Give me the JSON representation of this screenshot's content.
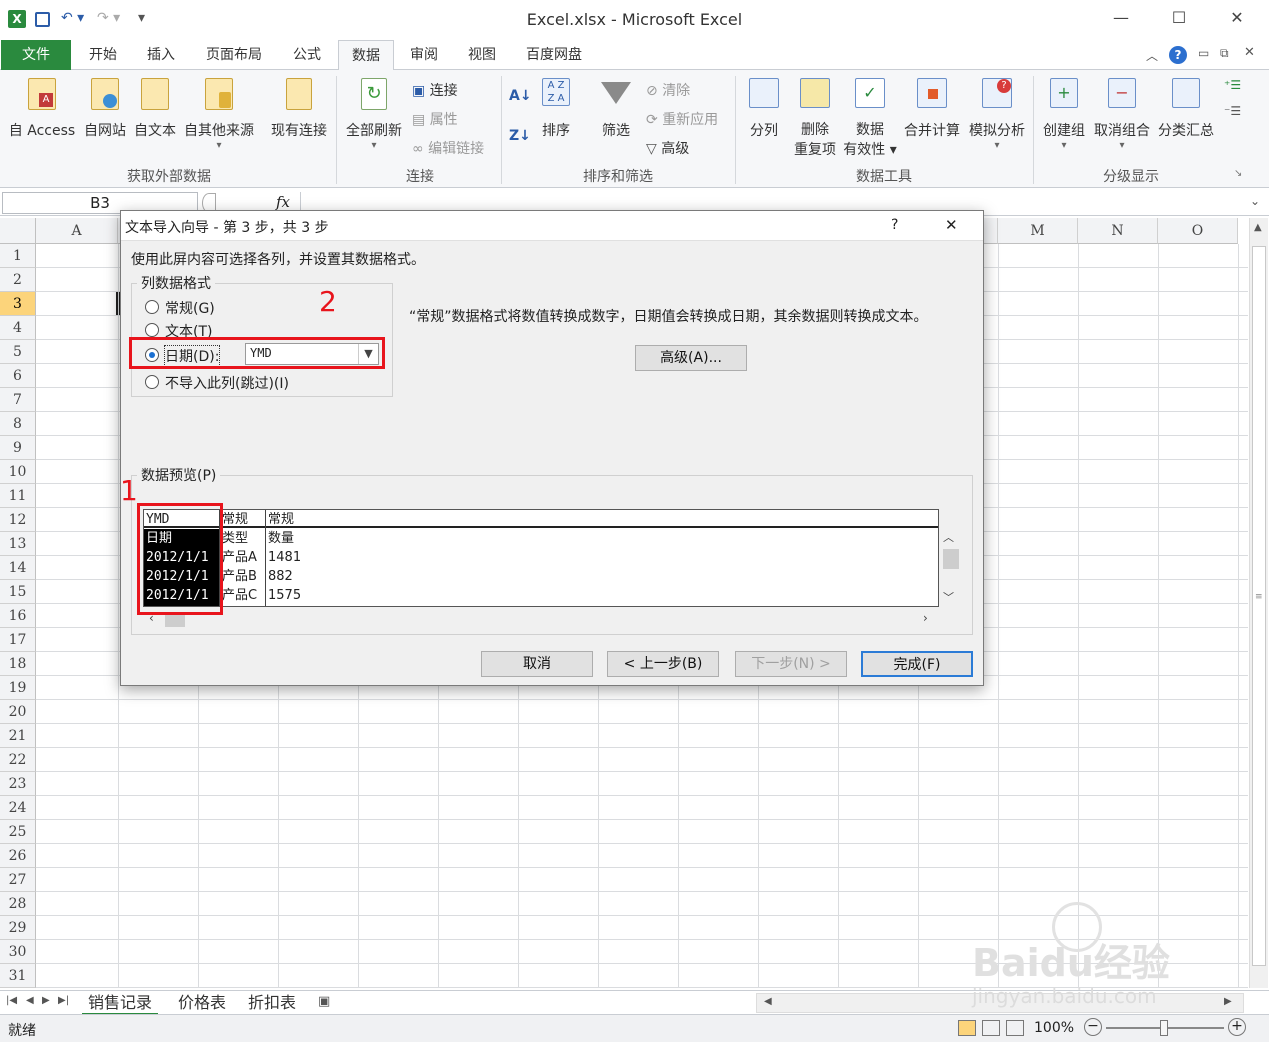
{
  "window": {
    "title": "Excel.xlsx - Microsoft Excel"
  },
  "quick_access": {
    "undo_label": "↶",
    "redo_label": "↷"
  },
  "window_controls": {
    "minimize": "—",
    "maximize": "☐",
    "close": "✕"
  },
  "tabs": [
    "文件",
    "开始",
    "插入",
    "页面布局",
    "公式",
    "数据",
    "审阅",
    "视图",
    "百度网盘"
  ],
  "active_tab": "数据",
  "ribbon": {
    "get_external": {
      "buttons": [
        "自 Access",
        "自网站",
        "自文本",
        "自其他来源",
        "现有连接"
      ],
      "group_label": "获取外部数据"
    },
    "connections": {
      "refresh_all": "全部刷新",
      "connections": "连接",
      "properties": "属性",
      "edit_links": "编辑链接",
      "group_label": "连接"
    },
    "sort_filter": {
      "sort": "排序",
      "filter": "筛选",
      "clear": "清除",
      "reapply": "重新应用",
      "advanced": "高级",
      "group_label": "排序和筛选"
    },
    "data_tools": {
      "text_to_columns": "分列",
      "remove_duplicates_1": "删除",
      "remove_duplicates_2": "重复项",
      "validation_1": "数据",
      "validation_2": "有效性",
      "consolidate": "合并计算",
      "what_if": "模拟分析",
      "group_label": "数据工具"
    },
    "outline": {
      "group": "创建组",
      "ungroup": "取消组合",
      "subtotal": "分类汇总",
      "group_label": "分级显示"
    }
  },
  "formula_bar": {
    "name_box": "B3",
    "fx": "fx",
    "formula": ""
  },
  "columns": [
    "A",
    "M",
    "N",
    "O"
  ],
  "rows": [
    "1",
    "2",
    "3",
    "4",
    "5",
    "6",
    "7",
    "8",
    "9",
    "10",
    "11",
    "12",
    "13",
    "14",
    "15",
    "16",
    "17",
    "18",
    "19",
    "20",
    "21",
    "22",
    "23",
    "24",
    "25",
    "26",
    "27",
    "28",
    "29",
    "30",
    "31"
  ],
  "selected_row": "3",
  "dialog": {
    "title": "文本导入向导 - 第 3 步，共 3 步",
    "help": "?",
    "close": "✕",
    "instruction": "使用此屏内容可选择各列，并设置其数据格式。",
    "column_format_label": "列数据格式",
    "options": [
      "常规(G)",
      "文本(T)",
      "日期(D):",
      "不导入此列(跳过)(I)"
    ],
    "selected_option": "日期(D):",
    "date_format": "YMD",
    "description": "“常规”数据格式将数值转换成数字，日期值会转换成日期，其余数据则转换成文本。",
    "advanced_button": "高级(A)...",
    "preview_label": "数据预览(P)",
    "preview": {
      "headers": [
        "YMD",
        "常规",
        "常规"
      ],
      "rows": [
        [
          "日期",
          "类型",
          "数量"
        ],
        [
          "2012/1/1",
          "产品A",
          "1481"
        ],
        [
          "2012/1/1",
          "产品B",
          "882"
        ],
        [
          "2012/1/1",
          "产品C",
          "1575"
        ]
      ]
    },
    "buttons": {
      "cancel": "取消",
      "back": "< 上一步(B)",
      "next": "下一步(N) >",
      "finish": "完成(F)"
    }
  },
  "annotations": {
    "marker1": "1",
    "marker2": "2",
    "color": "#e8141c"
  },
  "sheets": [
    "销售记录",
    "价格表",
    "折扣表"
  ],
  "active_sheet": "销售记录",
  "status": {
    "ready": "就绪",
    "zoom": "100%"
  },
  "watermark": {
    "brand": "Baidu经验",
    "url": "jingyan.baidu.com"
  },
  "colors": {
    "excel_green": "#2a8a3e",
    "row_selected": "#fcd47b",
    "accent_blue": "#2b7bd6"
  }
}
